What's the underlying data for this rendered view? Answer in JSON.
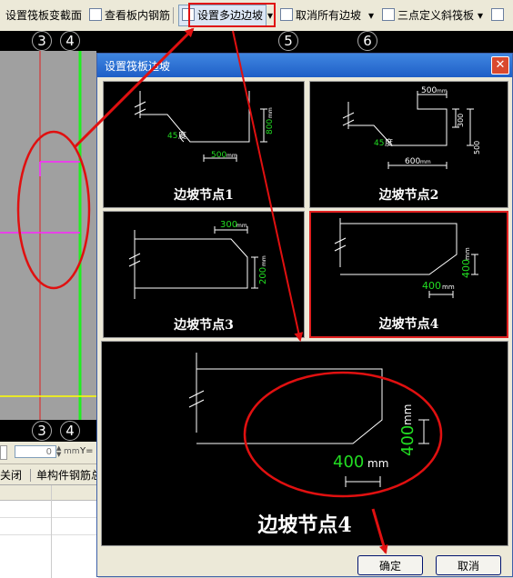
{
  "toolbar": {
    "items": [
      "设置筏板变截面",
      "查看板内钢筋",
      "设置多边边坡",
      "取消所有边坡",
      "三点定义斜筏板"
    ]
  },
  "axes": {
    "top": [
      "3",
      "4",
      "5",
      "6"
    ],
    "bottom": [
      "3",
      "4"
    ]
  },
  "bottom_panel": {
    "coord_value": "0",
    "unit": "mm",
    "y_label": "Y=",
    "close_label": "关闭",
    "rebar_label": "单构件钢筋总"
  },
  "dialog": {
    "title": "设置筏板边坡",
    "close_glyph": "✕",
    "nodes": [
      {
        "label": "边坡节点1",
        "angle": "45",
        "angle_unit": "度",
        "d1": "500",
        "d2": "800",
        "unit": "mm"
      },
      {
        "label": "边坡节点2",
        "angle": "45",
        "angle_unit": "度",
        "d1": "500",
        "d2": "300",
        "d3": "600",
        "d4": "500",
        "unit": "mm"
      },
      {
        "label": "边坡节点3",
        "d1": "300",
        "d2": "200",
        "unit": "mm"
      },
      {
        "label": "边坡节点4",
        "d1": "400",
        "d2": "400",
        "unit": "mm"
      }
    ],
    "preview": {
      "label": "边坡节点4",
      "d1": "400",
      "d2": "400",
      "unit": "mm"
    },
    "ok_label": "确定",
    "cancel_label": "取消"
  },
  "colors": {
    "accent": "#e01010",
    "selected_border": "#e02020",
    "dim_text": "#22dd22"
  }
}
